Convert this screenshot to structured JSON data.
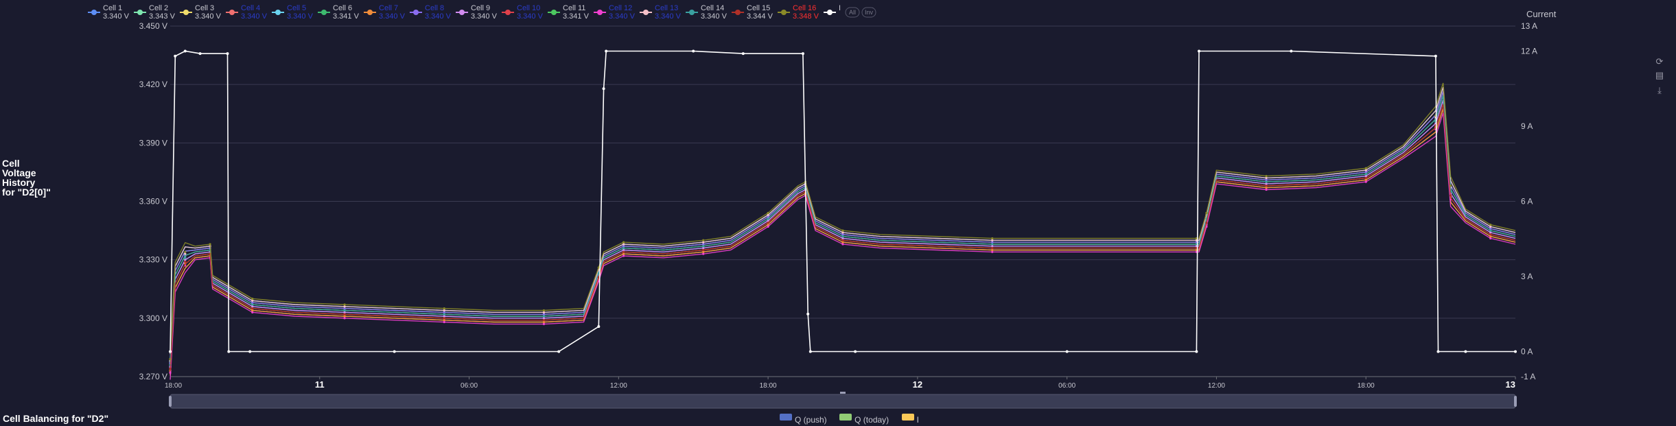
{
  "side_title": [
    "Cell",
    "Voltage",
    "History",
    " for \"D2[0]\""
  ],
  "bottom_title": "Cell Balancing for \"D2\"",
  "toolbox": [
    {
      "icon": "restore-icon",
      "glyph": "⟳"
    },
    {
      "icon": "data-view-icon",
      "glyph": "▤"
    },
    {
      "icon": "save-image-icon",
      "glyph": "⤓"
    }
  ],
  "bottom_legend": [
    {
      "label": "Q (push)",
      "color": "#5470c6"
    },
    {
      "label": "Q (today)",
      "color": "#91cc75"
    },
    {
      "label": "I",
      "color": "#fac858"
    }
  ],
  "chart_data": {
    "type": "line",
    "legend_position": "top",
    "grid": true,
    "y_axis_left": {
      "min": 3.27,
      "max": 3.45,
      "ticks": [
        "3.270 V",
        "3.300 V",
        "3.330 V",
        "3.360 V",
        "3.390 V",
        "3.420 V",
        "3.450 V"
      ]
    },
    "y_axis_right": {
      "title": "Current",
      "min": -1,
      "max": 13,
      "ticks": [
        "-1 A",
        "0 A",
        "3 A",
        "6 A",
        "9 A",
        "12 A",
        "13 A"
      ]
    },
    "x_axis": {
      "min": 0,
      "max": 30,
      "unit": "hours from 18:00",
      "ticks": [
        {
          "x": 0,
          "label": "18:00",
          "bold": false
        },
        {
          "x": 6,
          "label": "11",
          "bold": true
        },
        {
          "x": 12,
          "label": "06:00",
          "bold": false
        },
        {
          "x": 18,
          "label": "12:00",
          "bold": false
        },
        {
          "x": 24,
          "label": "18:00",
          "bold": false
        },
        {
          "x": 30,
          "label": "12",
          "bold": true
        },
        {
          "x": 36,
          "label": "06:00",
          "bold": false
        },
        {
          "x": 42,
          "label": "12:00",
          "bold": false
        },
        {
          "x": 48,
          "label": "18:00",
          "bold": false
        },
        {
          "x": 54,
          "label": "13",
          "bold": true
        }
      ]
    },
    "legend_extra": [
      "All",
      "Inv"
    ],
    "base_voltage": {
      "x": [
        0,
        0.2,
        0.6,
        1.0,
        1.6,
        1.7,
        3.3,
        5.0,
        7.0,
        9.0,
        11.0,
        13.0,
        15.0,
        16.6,
        17.2,
        17.4,
        18.2,
        19.8,
        21.4,
        22.5,
        24.0,
        25.2,
        25.5,
        25.9,
        27.0,
        28.5,
        33.0,
        38.0,
        41.2,
        41.3,
        41.6,
        42.0,
        44.0,
        46.0,
        48.0,
        49.5,
        50.8,
        51.1,
        51.4,
        52.0,
        53.0,
        54.0
      ],
      "y": [
        3.275,
        3.32,
        3.33,
        3.333,
        3.334,
        3.318,
        3.306,
        3.304,
        3.303,
        3.302,
        3.301,
        3.3,
        3.3,
        3.301,
        3.322,
        3.33,
        3.335,
        3.334,
        3.336,
        3.338,
        3.35,
        3.364,
        3.366,
        3.348,
        3.341,
        3.339,
        3.337,
        3.337,
        3.337,
        3.337,
        3.35,
        3.372,
        3.369,
        3.37,
        3.373,
        3.385,
        3.4,
        3.412,
        3.364,
        3.352,
        3.344,
        3.341
      ]
    },
    "series": [
      {
        "name": "Cell 1",
        "value": "3.340 V",
        "color": "#5d8ef5",
        "offset": 0.0
      },
      {
        "name": "Cell 2",
        "value": "3.343 V",
        "color": "#7ee6b0",
        "offset": 0.002
      },
      {
        "name": "Cell 3",
        "value": "3.340 V",
        "color": "#f0dc6a",
        "offset": -0.002
      },
      {
        "name": "Cell 4",
        "value": "3.340 V",
        "color": "#f07070",
        "offset": 0.001,
        "dim": true
      },
      {
        "name": "Cell 5",
        "value": "3.340 V",
        "color": "#6ad3f0",
        "offset": 0.003,
        "dim": true
      },
      {
        "name": "Cell 6",
        "value": "3.341 V",
        "color": "#3dba6f",
        "offset": -0.001
      },
      {
        "name": "Cell 7",
        "value": "3.340 V",
        "color": "#f08c3a",
        "offset": -0.002,
        "dim": true
      },
      {
        "name": "Cell 8",
        "value": "3.340 V",
        "color": "#8a6df0",
        "offset": 0.002,
        "dim": true
      },
      {
        "name": "Cell 9",
        "value": "3.340 V",
        "color": "#d28cf0",
        "offset": 0.0
      },
      {
        "name": "Cell 10",
        "value": "3.340 V",
        "color": "#e0404a",
        "offset": -0.001,
        "dim": true
      },
      {
        "name": "Cell 11",
        "value": "3.341 V",
        "color": "#4cc860",
        "offset": 0.001
      },
      {
        "name": "Cell 12",
        "value": "3.340 V",
        "color": "#f040d0",
        "offset": -0.003,
        "dim": true
      },
      {
        "name": "Cell 13",
        "value": "3.340 V",
        "color": "#f5c0c8",
        "offset": 0.003,
        "dim": true
      },
      {
        "name": "Cell 14",
        "value": "3.340 V",
        "color": "#3aa0a0",
        "offset": 0.001
      },
      {
        "name": "Cell 15",
        "value": "3.344 V",
        "color": "#b03028",
        "offset": -0.001
      },
      {
        "name": "Cell 16",
        "value": "3.348 V",
        "color": "#8a8a28",
        "offset": 0.004,
        "value_color": "#ff3030"
      }
    ],
    "current": {
      "name": "I",
      "color": "#ffffff",
      "x": [
        0,
        0.2,
        0.6,
        1.2,
        2.3,
        2.35,
        3.2,
        9.0,
        15.6,
        17.2,
        17.4,
        17.5,
        21.0,
        23.0,
        25.4,
        25.6,
        25.7,
        27.5,
        36.0,
        41.2,
        41.3,
        45.0,
        50.8,
        50.9,
        52.0,
        54.0
      ],
      "y": [
        0,
        11.8,
        12.0,
        11.9,
        11.9,
        0,
        0,
        0,
        0,
        1.0,
        10.5,
        12.0,
        12.0,
        11.9,
        11.9,
        1.5,
        0,
        0,
        0,
        0,
        12.0,
        12.0,
        11.8,
        0,
        0,
        0
      ]
    }
  }
}
